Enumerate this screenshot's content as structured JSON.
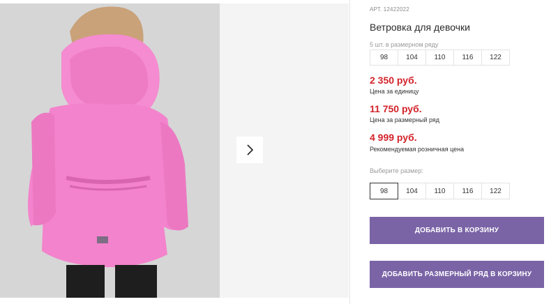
{
  "product": {
    "article": "АРТ. 12422022",
    "title": "Ветровка для девочки"
  },
  "size_row": {
    "label": "5 шт. в размерном ряду",
    "sizes": [
      "98",
      "104",
      "110",
      "116",
      "122"
    ]
  },
  "prices": [
    {
      "value": "2 350 руб.",
      "note": "Цена за единицу"
    },
    {
      "value": "11 750 руб.",
      "note": "Цена за размерный ряд"
    },
    {
      "value": "4 999 руб.",
      "note": "Рекомендуемая розничная цена"
    }
  ],
  "size_select": {
    "label": "Выберите размер:",
    "options": [
      "98",
      "104",
      "110",
      "116",
      "122"
    ],
    "selected": "98"
  },
  "buttons": {
    "add_to_cart": "ДОБАВИТЬ В КОРЗИНУ",
    "add_row_to_cart": "ДОБАВИТЬ РАЗМЕРНЫЙ РЯД В КОРЗИНУ"
  },
  "colors": {
    "price": "#d2232a",
    "button": "#7a64a6",
    "jacket": "#f07ac8"
  },
  "icons": {
    "next": "chevron-right-icon"
  }
}
